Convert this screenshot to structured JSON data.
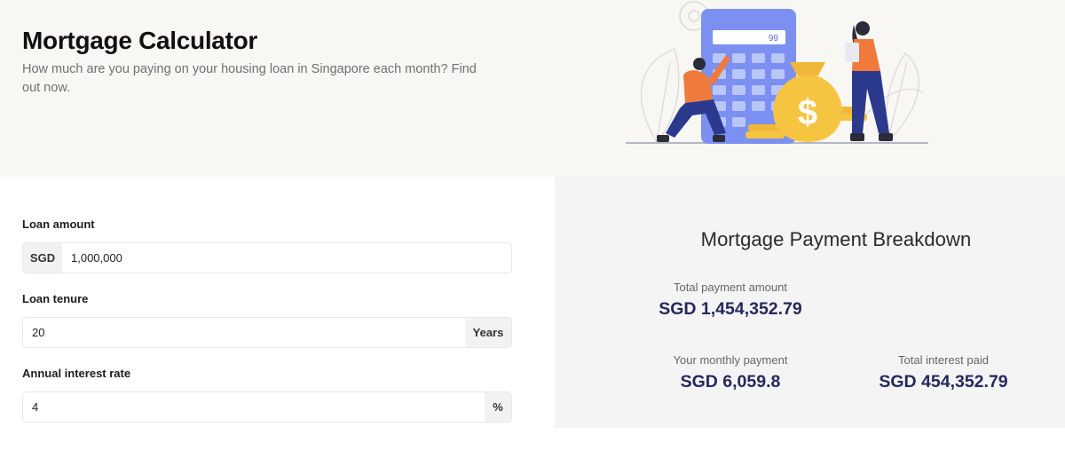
{
  "hero": {
    "title": "Mortgage Calculator",
    "subtitle": "How much are you paying on your housing loan in Singapore each month? Find out now."
  },
  "illustration": {
    "calculator_display": "99",
    "bag_symbol": "$",
    "icon": "money-bag-calculator-illustration",
    "colors": {
      "calculator": "#7b90f0",
      "bag": "#f5c542",
      "shirt": "#f07a3c",
      "pants": "#2b3a8c"
    }
  },
  "form": {
    "loan_amount": {
      "label": "Loan amount",
      "prefix": "SGD",
      "value": "1,000,000"
    },
    "loan_tenure": {
      "label": "Loan tenure",
      "value": "20",
      "suffix": "Years"
    },
    "interest_rate": {
      "label": "Annual interest rate",
      "value": "4",
      "suffix": "%"
    }
  },
  "breakdown": {
    "title": "Mortgage Payment Breakdown",
    "total_payment": {
      "label": "Total payment amount",
      "value": "SGD 1,454,352.79"
    },
    "monthly_payment": {
      "label": "Your monthly payment",
      "value": "SGD 6,059.8"
    },
    "total_interest": {
      "label": "Total interest paid",
      "value": "SGD 454,352.79"
    }
  },
  "colors": {
    "hero_bg": "#f8f7f4",
    "panel_bg": "#f4f4f4",
    "value_text": "#26285c"
  }
}
